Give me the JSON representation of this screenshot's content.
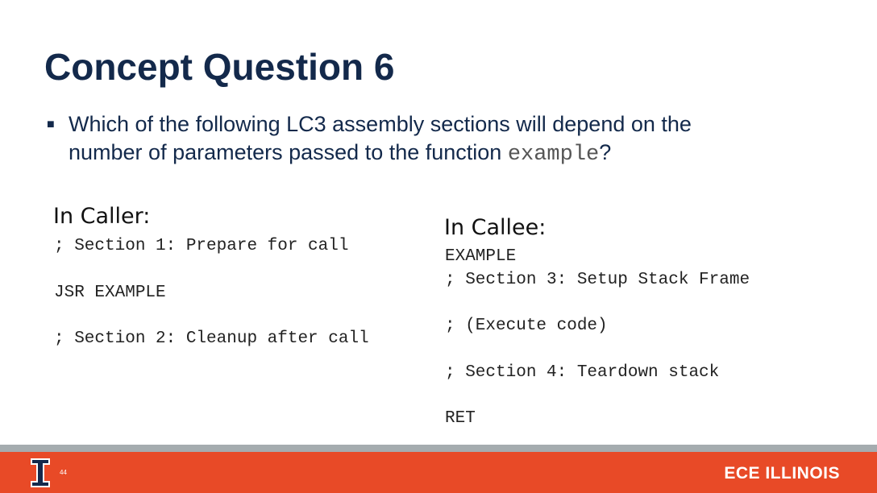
{
  "slide": {
    "title": "Concept Question 6",
    "bullet_before": "Which of the following LC3 assembly sections will depend on the",
    "bullet_line2_before": "number of parameters passed to the function ",
    "bullet_code": "example",
    "bullet_after": "?",
    "caller": {
      "heading": "In Caller:",
      "lines": [
        "; Section 1: Prepare for call",
        "JSR EXAMPLE",
        "; Section 2: Cleanup after call"
      ]
    },
    "callee": {
      "heading": "In Callee:",
      "lines": [
        "EXAMPLE",
        "; Section 3: Setup Stack Frame",
        "; (Execute code)",
        "; Section 4: Teardown stack",
        "RET"
      ]
    }
  },
  "footer": {
    "page_number": "44",
    "brand": "ECE ILLINOIS",
    "colors": {
      "orange": "#E84A27",
      "navy": "#13294B",
      "gray": "#A5ACAF"
    }
  }
}
